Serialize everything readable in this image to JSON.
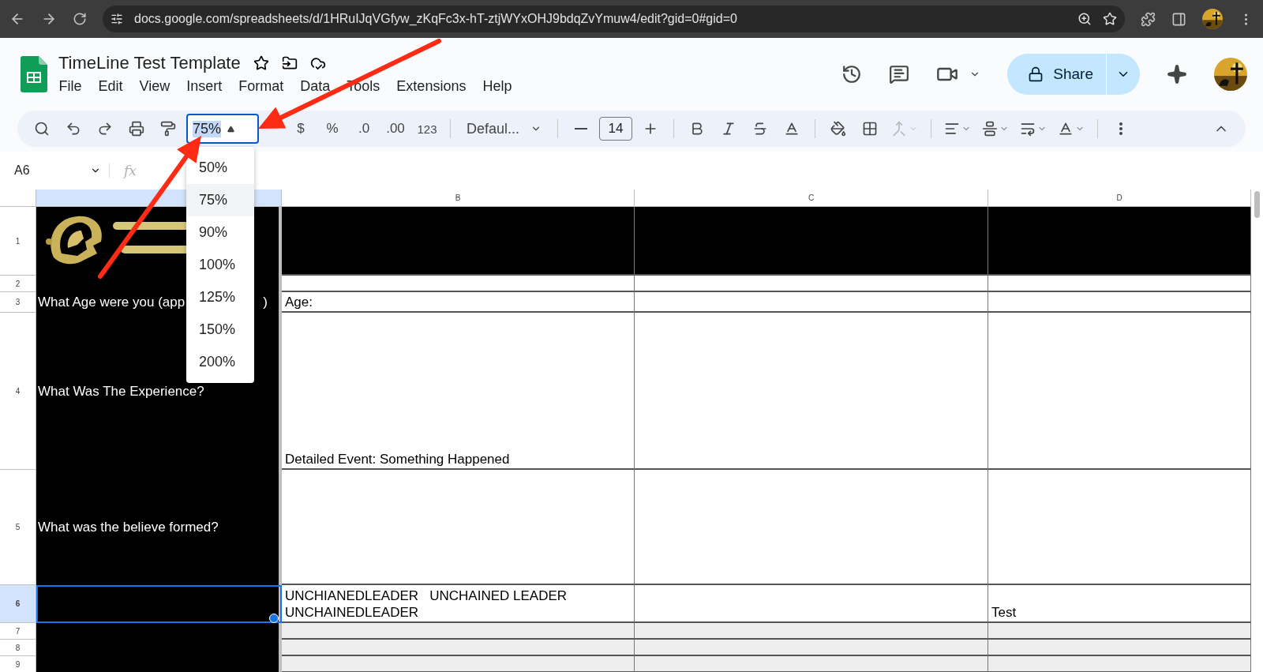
{
  "browser": {
    "url": "docs.google.com/spreadsheets/d/1HRuIJqVGfyw_zKqFc3x-hT-ztjWYxOHJ9bdqZvYmuw4/edit?gid=0#gid=0"
  },
  "document": {
    "title": "TimeLine Test Template"
  },
  "menus": [
    "File",
    "Edit",
    "View",
    "Insert",
    "Format",
    "Data",
    "Tools",
    "Extensions",
    "Help"
  ],
  "share": {
    "label": "Share"
  },
  "toolbar": {
    "zoom": "75%",
    "format_buttons": [
      "$",
      "%",
      ".0",
      ".00",
      "123"
    ],
    "font": "Defaul...",
    "font_size": "14"
  },
  "zoom_menu": [
    {
      "label": "50%",
      "selected": false
    },
    {
      "label": "75%",
      "selected": true
    },
    {
      "label": "90%",
      "selected": false
    },
    {
      "label": "100%",
      "selected": false
    },
    {
      "label": "125%",
      "selected": false
    },
    {
      "label": "150%",
      "selected": false
    },
    {
      "label": "200%",
      "selected": false
    }
  ],
  "name_box": "A6",
  "formula_label": "fx",
  "columns": [
    "B",
    "C",
    "D"
  ],
  "rows": [
    {
      "number": "1",
      "selected": false
    },
    {
      "number": "2",
      "selected": false
    },
    {
      "number": "3",
      "selected": false,
      "a": {
        "kind": "text",
        "text": "What Age were you (app",
        "tail": ")"
      },
      "b": {
        "kind": "text",
        "text": "Age:"
      }
    },
    {
      "number": "4",
      "selected": false,
      "a": {
        "kind": "text",
        "text": "What Was The Experience?"
      },
      "b": {
        "kind": "text",
        "text": "Detailed Event: Something Happened"
      }
    },
    {
      "number": "5",
      "selected": false,
      "a": {
        "kind": "text",
        "text": "What was the believe formed?"
      }
    },
    {
      "number": "6",
      "selected": true,
      "b": {
        "kind": "text",
        "text": "UNCHIANEDLEADER   UNCHAINED LEADER UNCHAINEDLEADER"
      },
      "d": {
        "kind": "text",
        "text": "Test"
      }
    },
    {
      "number": "7",
      "selected": false
    },
    {
      "number": "8",
      "selected": false
    },
    {
      "number": "9",
      "selected": false
    }
  ]
}
